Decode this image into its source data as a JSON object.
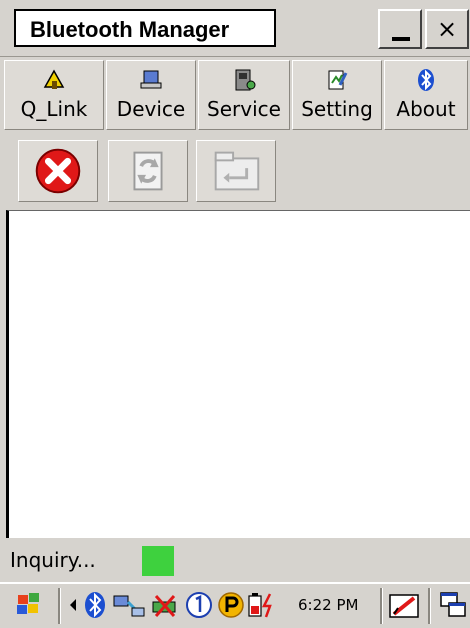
{
  "window": {
    "title": "Bluetooth Manager",
    "minimize_icon": "minimize-icon",
    "close_glyph": "×"
  },
  "toolbar": [
    {
      "label": "Q_Link",
      "icon": "quick-link-icon"
    },
    {
      "label": "Device",
      "icon": "device-icon"
    },
    {
      "label": "Service",
      "icon": "service-icon"
    },
    {
      "label": "Setting",
      "icon": "setting-icon"
    },
    {
      "label": "About",
      "icon": "bluetooth-icon"
    }
  ],
  "actions": [
    {
      "icon": "stop-icon",
      "enabled": true
    },
    {
      "icon": "refresh-icon",
      "enabled": false
    },
    {
      "icon": "connect-icon",
      "enabled": false
    }
  ],
  "status": {
    "text": "Inquiry...",
    "indicator_color": "#3ed13e"
  },
  "taskbar": {
    "clock": "6:22 PM",
    "tray_icons": [
      "windows-start-icon",
      "tray-arrow-icon",
      "bluetooth-tray-icon",
      "network-tray-icon",
      "battery-warning-icon",
      "info-circle-icon",
      "p-circle-icon",
      "power-icon",
      "edit-icon",
      "windows-icon"
    ]
  }
}
